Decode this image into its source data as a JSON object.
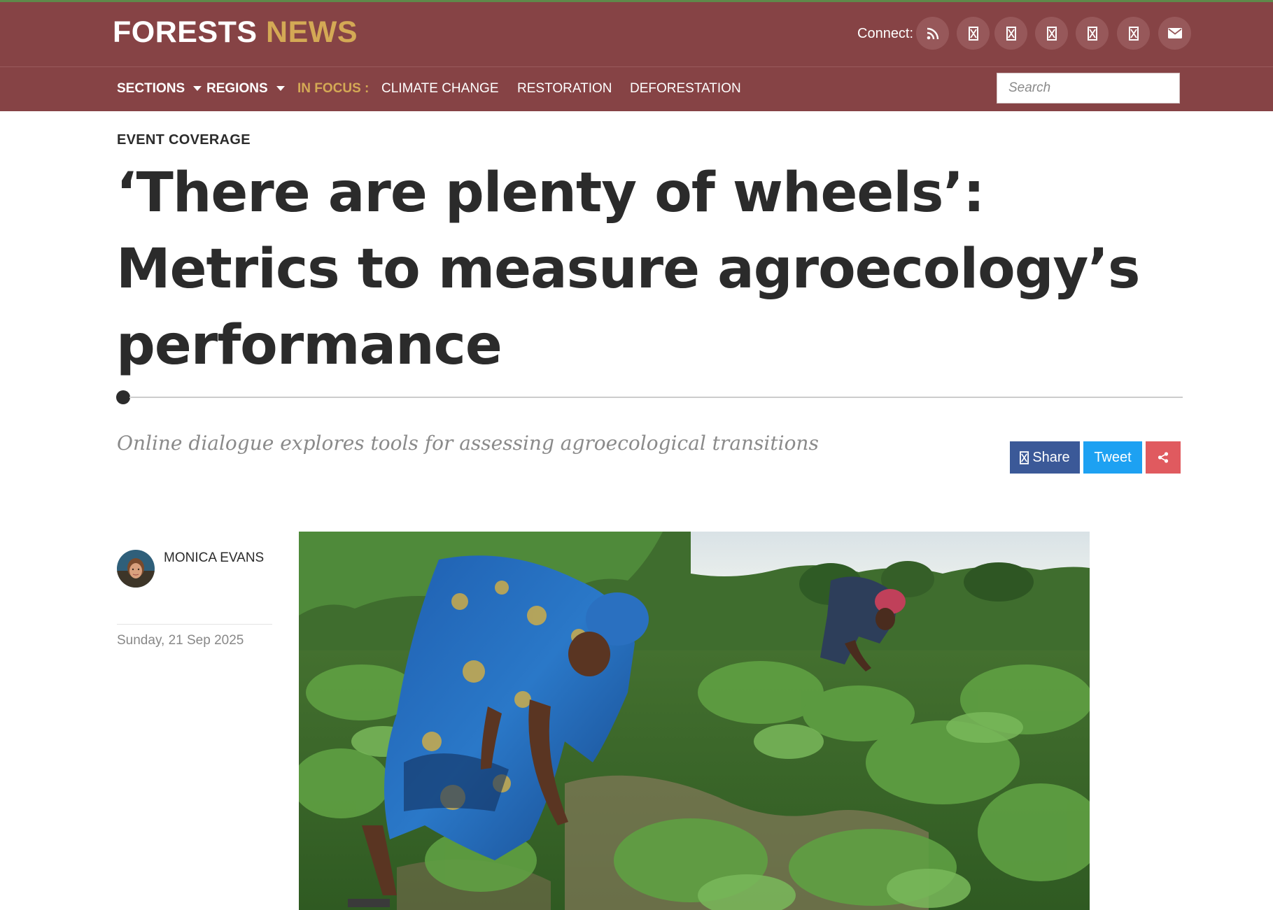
{
  "site": {
    "logo_word1": "FORESTS",
    "logo_word2": "NEWS",
    "brand_color": "#864345",
    "accent_color": "#d4a955"
  },
  "connect": {
    "label": "Connect:",
    "icons": [
      "rss-icon",
      "social-icon",
      "social-icon",
      "social-icon",
      "social-icon",
      "social-icon",
      "email-icon"
    ]
  },
  "nav": {
    "sections": "SECTIONS",
    "regions": "REGIONS",
    "in_focus": "IN FOCUS :",
    "links": [
      "CLIMATE CHANGE",
      "RESTORATION",
      "DEFORESTATION"
    ],
    "search_placeholder": "Search"
  },
  "article": {
    "category": "EVENT COVERAGE",
    "title": "‘There are plenty of wheels’: Metrics to measure agroecology’s performance",
    "subtitle": "Online dialogue explores tools for assessing agroecological transitions",
    "author": "MONICA EVANS",
    "date": "Sunday, 21 Sep 2025"
  },
  "share": {
    "share_label": "Share",
    "tweet_label": "Tweet",
    "share_color": "#3b5998",
    "tweet_color": "#1da1f2",
    "more_color": "#e05a5f"
  }
}
